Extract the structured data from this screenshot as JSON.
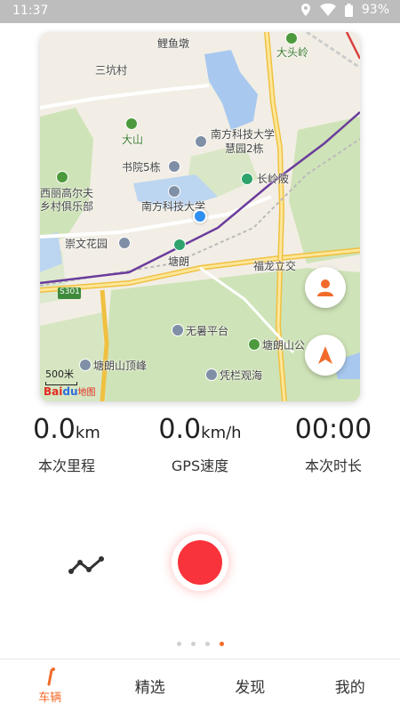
{
  "status_bar": {
    "time": "11:37",
    "battery": "93%"
  },
  "map": {
    "labels": {
      "liyudun": "鲤鱼墩",
      "datouling": "大头岭",
      "sankengcun": "三坑村",
      "dashan": "大山",
      "sustech_huiyuan": "南方科技大学",
      "sustech_huiyuan2": "慧园2栋",
      "shuyuan5": "书院5栋",
      "changlingpi": "长岭陂",
      "golf": "西丽高尔夫",
      "golf2": "乡村俱乐部",
      "sustech": "南方科技大学",
      "chongwen": "崇文花园",
      "tanglang": "塘朗",
      "fulong": "福龙立交",
      "road_s301": "S301",
      "wushu": "无暑平台",
      "tanglangshan_park": "塘朗山公",
      "tanglangshan_peak": "塘朗山顶峰",
      "pinglan": "凭栏观海"
    },
    "scale": "500米",
    "logo_bai": "Bai",
    "logo_du": "du",
    "logo_map": "地图"
  },
  "stats": [
    {
      "value": "0.0",
      "unit": "km",
      "label": "本次里程"
    },
    {
      "value": "0.0",
      "unit": "km/h",
      "label": "GPS速度"
    },
    {
      "value": "00:00",
      "unit": "",
      "label": "本次时长"
    }
  ],
  "pager": {
    "count": 4,
    "active": 3
  },
  "nav": [
    {
      "label": "车辆",
      "active": true
    },
    {
      "label": "精选",
      "active": false
    },
    {
      "label": "发现",
      "active": false
    },
    {
      "label": "我的",
      "active": false
    }
  ],
  "colors": {
    "accent": "#f26b2a",
    "record": "#f8333b",
    "location": "#2f8ff0"
  }
}
